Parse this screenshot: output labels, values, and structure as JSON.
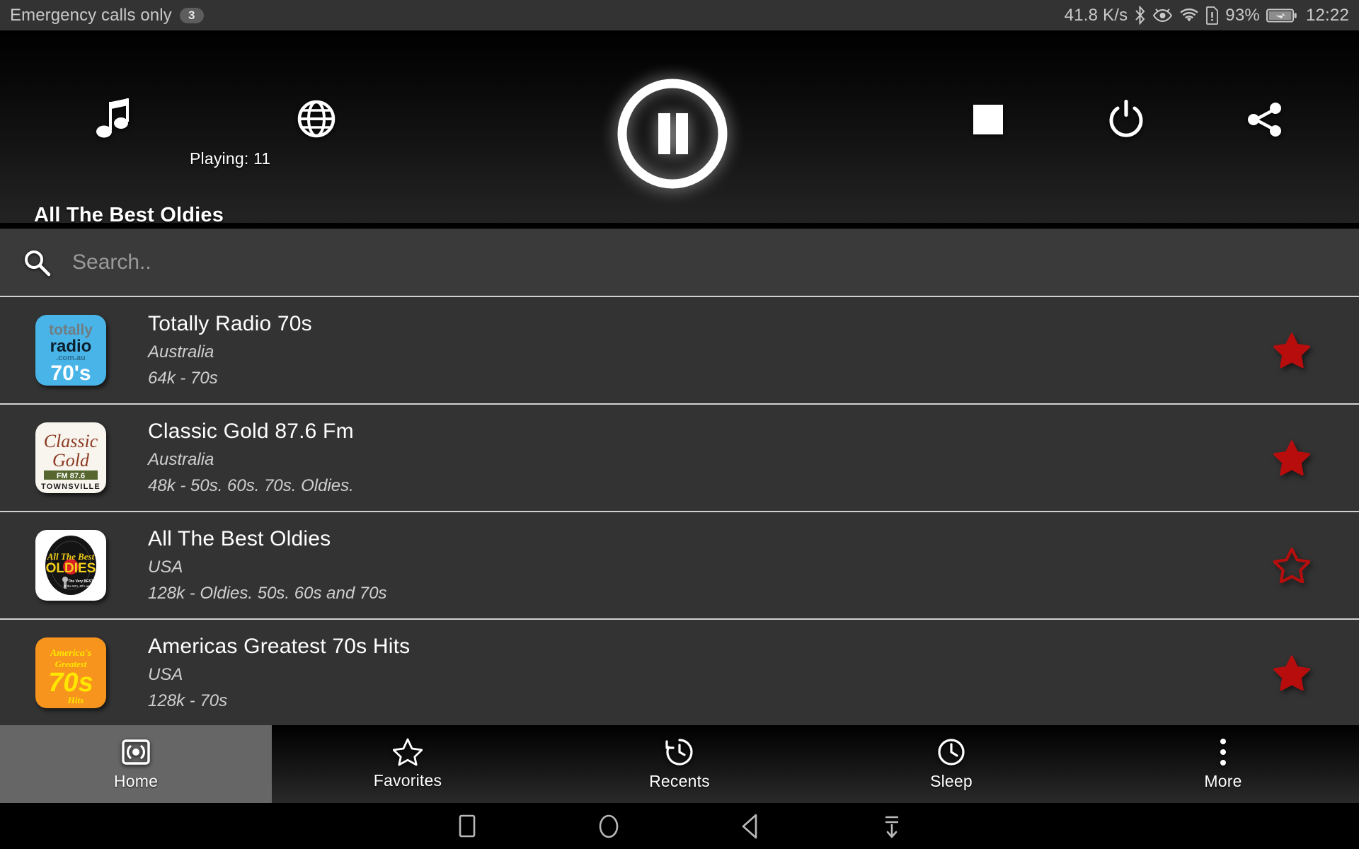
{
  "statusbar": {
    "carrier": "Emergency calls only",
    "notification_count": "3",
    "network_speed": "41.8 K/s",
    "icons": [
      "bluetooth-icon",
      "eye-icon",
      "wifi-icon",
      "sim-alert-icon",
      "battery-charging-icon"
    ],
    "battery_percent": "93%",
    "time": "12:22"
  },
  "player": {
    "music_icon": "music-note-icon",
    "globe_icon": "globe-icon",
    "playing_label": "Playing: 11",
    "transport_icon": "pause-icon",
    "stop_icon": "stop-square-icon",
    "power_icon": "power-icon",
    "share_icon": "share-icon",
    "now_playing_title": "All The Best Oldies"
  },
  "search": {
    "icon": "search-icon",
    "placeholder": "Search..",
    "value": ""
  },
  "stations": [
    {
      "name": "Totally Radio 70s",
      "country": "Australia",
      "meta": "64k - 70s",
      "favorite": true,
      "logo": "totally-radio-70s-logo",
      "logo_colors": {
        "bg": "#49b4e8",
        "text": "#0d2230",
        "accent": "#ffffff"
      },
      "logo_lines": [
        "totally",
        "radio",
        ".com.au",
        "70's"
      ]
    },
    {
      "name": "Classic Gold 87.6 Fm",
      "country": "Australia",
      "meta": "48k - 50s. 60s. 70s. Oldies.",
      "favorite": true,
      "logo": "classic-gold-logo",
      "logo_colors": {
        "bg": "#f7f5ee",
        "text": "#8c3a22",
        "accent": "#56662f"
      },
      "logo_lines": [
        "Classic",
        "Gold",
        "FM 87.6",
        "TOWNSVILLE"
      ]
    },
    {
      "name": "All The Best Oldies",
      "country": "USA",
      "meta": "128k - Oldies. 50s. 60s and 70s",
      "favorite": false,
      "logo": "all-the-best-oldies-logo",
      "logo_colors": {
        "bg": "#ffffff",
        "text": "#f3d11a",
        "accent": "#d81f26"
      },
      "logo_lines": [
        "All The Best",
        "OLDIES",
        "The Very BEST",
        "of the 50's, 60's and 70's"
      ]
    },
    {
      "name": "Americas Greatest 70s Hits",
      "country": "USA",
      "meta": "128k - 70s",
      "favorite": true,
      "logo": "americas-greatest-70s-hits-logo",
      "logo_colors": {
        "bg": "#f7941e",
        "text": "#ffe600",
        "accent": "#7a3b06"
      },
      "logo_lines": [
        "America's",
        "Greatest",
        "70s",
        "Hits"
      ]
    }
  ],
  "favorite_star_color": "#b80d0d",
  "bottom_nav": {
    "active": "Home",
    "items": [
      {
        "label": "Home",
        "icon": "broadcast-icon"
      },
      {
        "label": "Favorites",
        "icon": "star-outline-icon"
      },
      {
        "label": "Recents",
        "icon": "history-icon"
      },
      {
        "label": "Sleep",
        "icon": "clock-icon"
      },
      {
        "label": "More",
        "icon": "more-vertical-icon"
      }
    ]
  },
  "android_nav": {
    "items": [
      {
        "icon": "recents-square-icon"
      },
      {
        "icon": "home-circle-icon"
      },
      {
        "icon": "back-triangle-icon"
      },
      {
        "icon": "hide-keyboard-icon"
      }
    ]
  }
}
